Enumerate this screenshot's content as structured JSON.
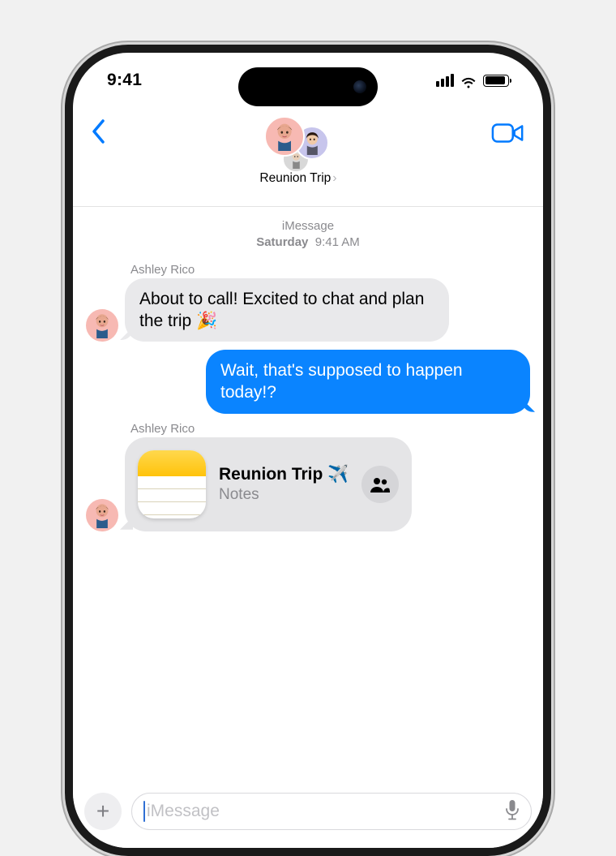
{
  "statusbar": {
    "time": "9:41"
  },
  "header": {
    "group_name": "Reunion Trip"
  },
  "thread": {
    "service": "iMessage",
    "timestamp_day": "Saturday",
    "timestamp_time": "9:41 AM",
    "messages": [
      {
        "sender": "Ashley Rico",
        "side": "left",
        "text": "About to call! Excited to chat and plan the trip 🎉"
      },
      {
        "side": "right",
        "text": "Wait, that's supposed to happen today!?"
      },
      {
        "sender": "Ashley Rico",
        "side": "left",
        "attachment": {
          "title": "Reunion Trip ✈️",
          "app": "Notes"
        }
      }
    ]
  },
  "composer": {
    "placeholder": "iMessage"
  }
}
